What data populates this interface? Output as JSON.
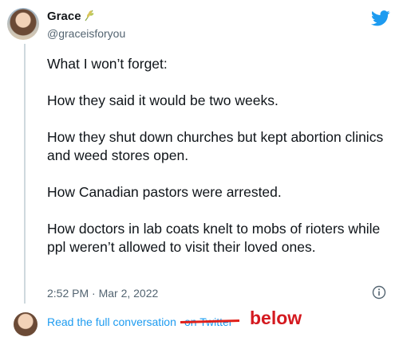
{
  "author": {
    "name": "Grace",
    "handle": "@graceisforyou"
  },
  "tweet": {
    "paragraphs": [
      "What I won’t forget:",
      "How they said it would be two weeks.",
      "How they shut down churches but kept abortion clinics and weed stores open.",
      "How Canadian pastors were arrested.",
      "How doctors in lab coats knelt to mobs of rioters while ppl weren’t allowed to visit their loved ones."
    ],
    "timestamp": "2:52 PM · Mar 2, 2022"
  },
  "footer": {
    "full_conversation": "Read the full conversation",
    "on_twitter": "on Twitter",
    "annotation": "below"
  },
  "colors": {
    "link": "#1d9bf0",
    "annotation": "#d4191f",
    "text": "#0f1419",
    "muted": "#536471"
  },
  "icons": {
    "brand": "twitter-bird-icon",
    "badge": "wheat-emoji-icon",
    "info": "info-icon"
  }
}
